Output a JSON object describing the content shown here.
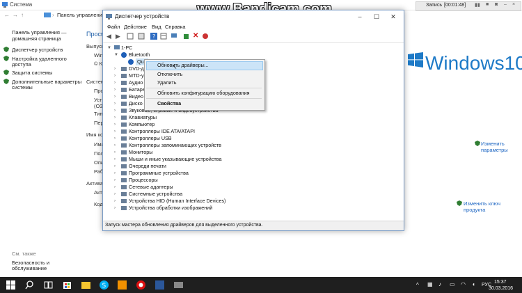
{
  "bg_window": {
    "title": "Система",
    "nav_path": "Панель управления",
    "left_links": [
      "Панель управления —",
      "домашняя страница",
      "Диспетчер устройств",
      "Настройка удаленного",
      "доступа",
      "Защита системы",
      "Дополнительные параметры",
      "системы"
    ],
    "see_also_title": "См. также",
    "see_also_links": [
      "Безопасность и",
      "обслуживание"
    ],
    "section_labels": [
      "Просм",
      "Выпуск",
      "Win",
      "© К",
      "Систем",
      "Про",
      "Уст",
      "(ОЗ",
      "Тип",
      "Пер",
      "Имя ко",
      "Ими",
      "Пол",
      "Опи",
      "Раб",
      "Активац",
      "Акт",
      "Код"
    ],
    "win10_text": "Windows10",
    "change_params_link": [
      "Изменить",
      "параметры"
    ],
    "change_key_link": "Изменить ключ продукта"
  },
  "bandicam": {
    "watermark": "www.Bandicam.com",
    "rec_label": "Запись",
    "rec_time": "[00:01:48]"
  },
  "device_manager": {
    "title": "Диспетчер устройств",
    "menu": [
      "Файл",
      "Действие",
      "Вид",
      "Справка"
    ],
    "root": "1-PC",
    "bluetooth": "Bluetooth",
    "bt_child": "Qua",
    "partial_items": [
      "DVD-ди",
      "MTD-ус",
      "Аудио",
      "Батаре",
      "Видео",
      "Диско",
      "Звуковые, игровые и видеоустройства"
    ],
    "items": [
      "Клавиатуры",
      "Компьютер",
      "Контроллеры IDE ATA/ATAPI",
      "Контроллеры USB",
      "Контроллеры запоминающих устройств",
      "Мониторы",
      "Мыши и иные указывающие устройства",
      "Очереди печати",
      "Программные устройства",
      "Процессоры",
      "Сетевые адаптеры",
      "Системные устройства",
      "Устройства HID (Human Interface Devices)",
      "Устройства обработки изображений"
    ],
    "status": "Запуск мастера обновления драйверов для выделенного устройства."
  },
  "context_menu": {
    "items": [
      "Обновить драйверы...",
      "Отключить",
      "Удалить",
      "Обновить конфигурацию оборудования",
      "Свойства"
    ]
  },
  "taskbar": {
    "lang": "РУС",
    "time": "15:37",
    "date": "30.03.2016"
  },
  "colors": {
    "win_blue": "#1e7ac7",
    "taskbar": "#1f1f1f",
    "highlight": "#cce4f7"
  }
}
